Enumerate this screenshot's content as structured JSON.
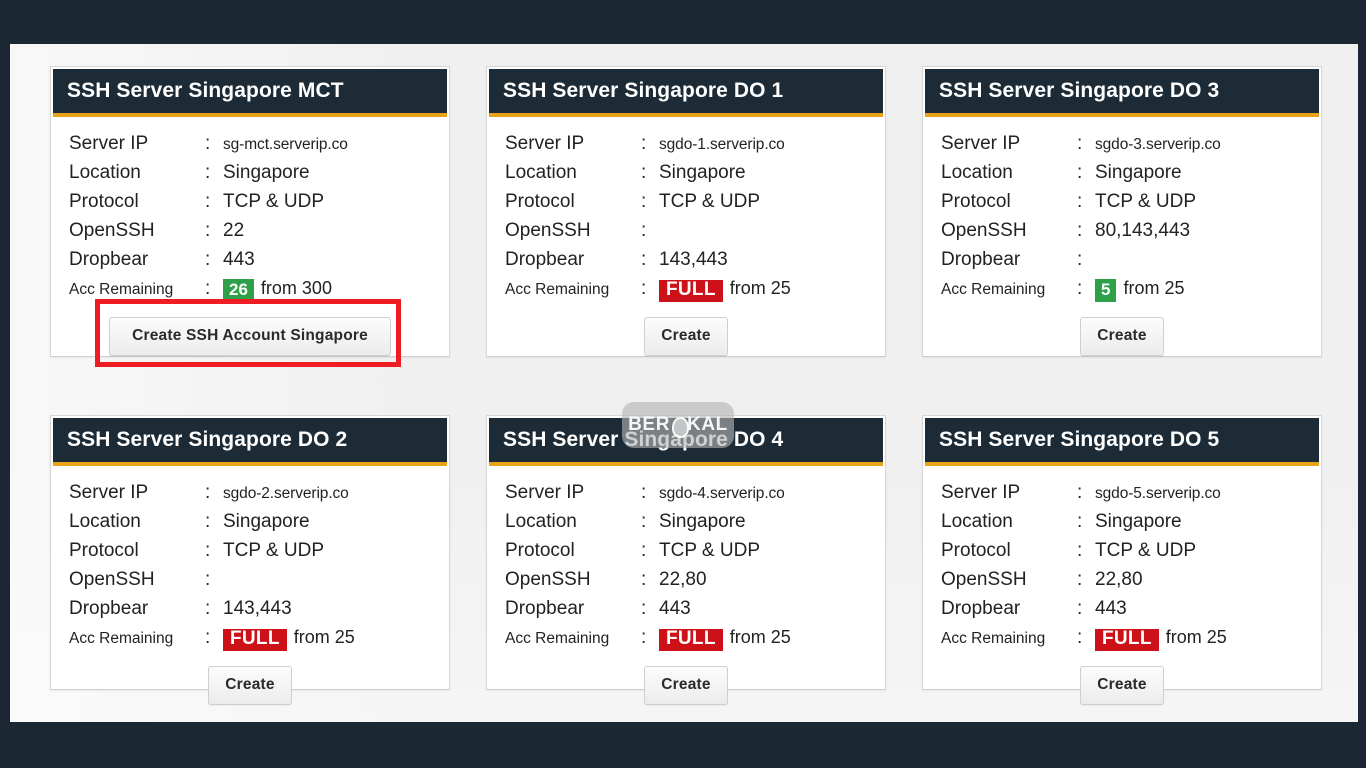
{
  "theme": {
    "page_background": "#f0f0f0",
    "letterbox": "#1b2733",
    "header_bg": "#1c2b36",
    "header_accent": "#e8a317",
    "badge_green": "#2fa04a",
    "badge_red": "#cc1118",
    "annotation_red": "#ee1d24"
  },
  "labels": {
    "server_ip": "Server IP",
    "location": "Location",
    "protocol": "Protocol",
    "openssh": "OpenSSH",
    "dropbear": "Dropbear",
    "acc_remaining": "Acc Remaining",
    "colon": ":",
    "from_prefix": "from"
  },
  "watermark": {
    "part1": "BER",
    "part2": "KAL"
  },
  "cards": [
    {
      "title": "SSH Server Singapore MCT",
      "server_ip": "sg-mct.serverip.co",
      "location": "Singapore",
      "protocol": "TCP & UDP",
      "openssh": "22",
      "dropbear": "443",
      "acc_badge": "26",
      "acc_badge_kind": "green",
      "acc_total": "from 300",
      "button": "Create SSH Account Singapore",
      "highlighted": true
    },
    {
      "title": "SSH Server Singapore DO 1",
      "server_ip": "sgdo-1.serverip.co",
      "location": "Singapore",
      "protocol": "TCP & UDP",
      "openssh": "",
      "dropbear": "143,443",
      "acc_badge": "FULL",
      "acc_badge_kind": "red",
      "acc_total": "from 25",
      "button": "Create",
      "highlighted": false
    },
    {
      "title": "SSH Server Singapore DO 3",
      "server_ip": "sgdo-3.serverip.co",
      "location": "Singapore",
      "protocol": "TCP & UDP",
      "openssh": "80,143,443",
      "dropbear": "",
      "acc_badge": "5",
      "acc_badge_kind": "green",
      "acc_total": "from 25",
      "button": "Create",
      "highlighted": false
    },
    {
      "title": "SSH Server Singapore DO 2",
      "server_ip": "sgdo-2.serverip.co",
      "location": "Singapore",
      "protocol": "TCP & UDP",
      "openssh": "",
      "dropbear": "143,443",
      "acc_badge": "FULL",
      "acc_badge_kind": "red",
      "acc_total": "from 25",
      "button": "Create",
      "highlighted": false
    },
    {
      "title": "SSH Server Singapore DO 4",
      "server_ip": "sgdo-4.serverip.co",
      "location": "Singapore",
      "protocol": "TCP & UDP",
      "openssh": "22,80",
      "dropbear": "443",
      "acc_badge": "FULL",
      "acc_badge_kind": "red",
      "acc_total": "from 25",
      "button": "Create",
      "highlighted": false
    },
    {
      "title": "SSH Server Singapore DO 5",
      "server_ip": "sgdo-5.serverip.co",
      "location": "Singapore",
      "protocol": "TCP & UDP",
      "openssh": "22,80",
      "dropbear": "443",
      "acc_badge": "FULL",
      "acc_badge_kind": "red",
      "acc_total": "from 25",
      "button": "Create",
      "highlighted": false
    }
  ]
}
